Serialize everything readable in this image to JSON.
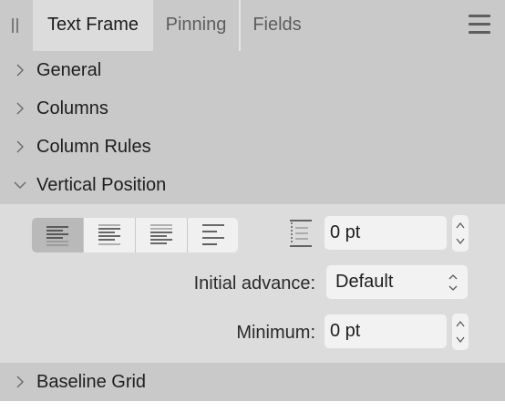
{
  "tabs": [
    {
      "label": "Text Frame",
      "active": true
    },
    {
      "label": "Pinning",
      "active": false
    },
    {
      "label": "Fields",
      "active": false
    }
  ],
  "icons": {
    "grip": "drag-grip-icon",
    "menu": "hamburger-menu-icon",
    "collapsed": "chevron-right-icon",
    "expanded": "chevron-down-icon"
  },
  "sections": [
    {
      "label": "General",
      "expanded": false
    },
    {
      "label": "Columns",
      "expanded": false
    },
    {
      "label": "Column Rules",
      "expanded": false
    },
    {
      "label": "Vertical Position",
      "expanded": true
    },
    {
      "label": "Baseline Grid",
      "expanded": false
    }
  ],
  "vertical_position": {
    "alignment_options": [
      "top",
      "center",
      "bottom",
      "justify"
    ],
    "selected_alignment": "top",
    "inset_value": "0 pt",
    "initial_advance_label": "Initial advance:",
    "initial_advance_value": "Default",
    "minimum_label": "Minimum:",
    "minimum_value": "0 pt"
  },
  "colors": {
    "panel_bg": "#c9c9c9",
    "active_tab_bg": "#dcdcdc",
    "field_bg": "#f2f2f2",
    "selected_segment_bg": "#b9b9b9"
  }
}
